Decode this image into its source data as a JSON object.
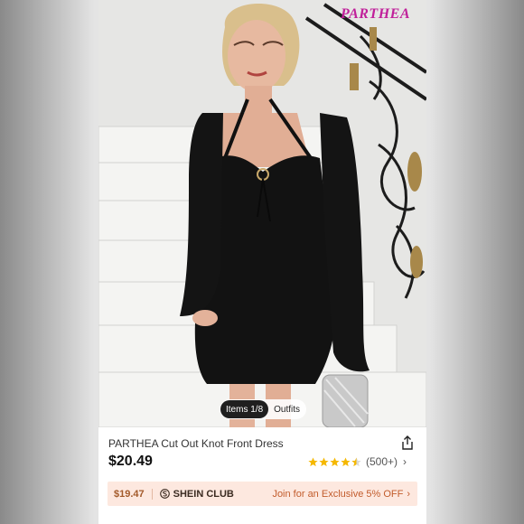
{
  "product": {
    "brand_logo": "PARTHEA",
    "title": "PARTHEA Cut Out Knot Front Dress",
    "price": "$20.49"
  },
  "gallery": {
    "tabs": [
      {
        "label": "Items 1/8",
        "active": true
      },
      {
        "label": "Outfits",
        "active": false
      }
    ]
  },
  "rating": {
    "stars": 4.5,
    "count": "(500+)",
    "chevron": "›"
  },
  "club_banner": {
    "member_price": "$19.47",
    "club_name": "SHEIN CLUB",
    "cta": "Join for an Exclusive 5% OFF",
    "chevron": "›"
  },
  "colors": {
    "accent_star": "#f5b800",
    "club_bg": "#fde8df",
    "club_text": "#c25c2c",
    "logo": "#c0209a"
  },
  "icons": [
    "share-icon",
    "star-icon",
    "club-s-icon",
    "chevron-right-icon"
  ]
}
